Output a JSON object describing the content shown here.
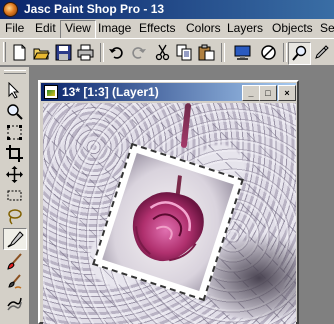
{
  "app": {
    "title": "Jasc Paint Shop Pro - 13"
  },
  "menubar": {
    "items": [
      {
        "label": "File"
      },
      {
        "label": "Edit"
      },
      {
        "label": "View"
      },
      {
        "label": "Image"
      },
      {
        "label": "Effects"
      },
      {
        "label": "Colors"
      },
      {
        "label": "Layers"
      },
      {
        "label": "Objects"
      },
      {
        "label": "Sel"
      }
    ],
    "active": "View"
  },
  "toolbar": {
    "icons": [
      "new-icon",
      "open-icon",
      "save-icon",
      "print-icon",
      "undo-icon",
      "redo-icon",
      "cut-icon",
      "copy-icon",
      "paste-icon",
      "display-icon",
      "circle-slash-icon",
      "zoom-icon",
      "dropper-icon"
    ]
  },
  "tools": {
    "icons": [
      "arrow-icon",
      "zoom-tool-icon",
      "deform-icon",
      "crop-icon",
      "move-icon",
      "selection-icon",
      "lasso-icon",
      "dropper-tool-icon",
      "paintbrush-icon",
      "clone-brush-icon",
      "retouch-icon"
    ],
    "active": "dropper-tool-icon"
  },
  "document": {
    "title": "13* [1:3] (Layer1)",
    "buttons": {
      "minimize": "_",
      "maximize": "□",
      "close": "×"
    }
  }
}
